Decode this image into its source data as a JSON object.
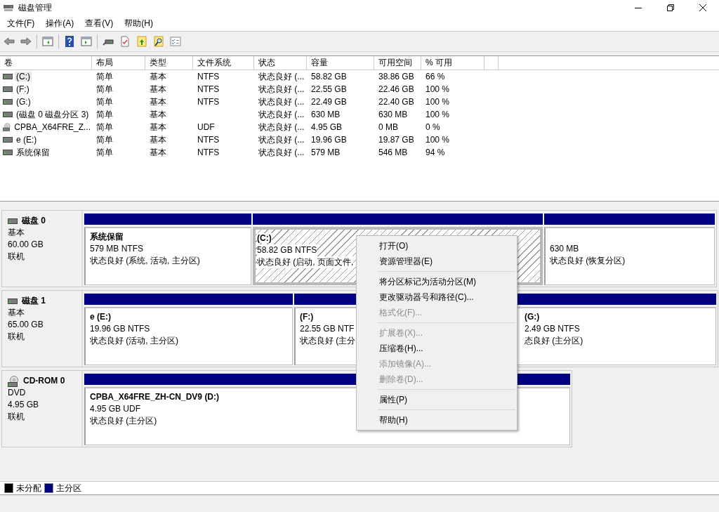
{
  "window": {
    "title": "磁盘管理"
  },
  "menu_bar": [
    "文件(F)",
    "操作(A)",
    "查看(V)",
    "帮助(H)"
  ],
  "table": {
    "columns": [
      "卷",
      "布局",
      "类型",
      "文件系统",
      "状态",
      "容量",
      "可用空间",
      "% 可用"
    ],
    "rows": [
      {
        "kind": "drive",
        "selected": true,
        "cells": [
          " (C:)",
          "简单",
          "基本",
          "NTFS",
          "状态良好 (...",
          "58.82 GB",
          "38.86 GB",
          "66 %"
        ]
      },
      {
        "kind": "drive",
        "selected": false,
        "cells": [
          " (F:)",
          "简单",
          "基本",
          "NTFS",
          "状态良好 (...",
          "22.55 GB",
          "22.46 GB",
          "100 %"
        ]
      },
      {
        "kind": "drive",
        "selected": false,
        "cells": [
          " (G:)",
          "简单",
          "基本",
          "NTFS",
          "状态良好 (...",
          "22.49 GB",
          "22.40 GB",
          "100 %"
        ]
      },
      {
        "kind": "drive",
        "selected": false,
        "cells": [
          "(磁盘 0 磁盘分区 3)",
          "简单",
          "基本",
          "",
          "状态良好 (...",
          "630 MB",
          "630 MB",
          "100 %"
        ]
      },
      {
        "kind": "cdrom",
        "selected": false,
        "cells": [
          "CPBA_X64FRE_Z...",
          "简单",
          "基本",
          "UDF",
          "状态良好 (...",
          "4.95 GB",
          "0 MB",
          "0 %"
        ]
      },
      {
        "kind": "drive",
        "selected": false,
        "cells": [
          "e (E:)",
          "简单",
          "基本",
          "NTFS",
          "状态良好 (...",
          "19.96 GB",
          "19.87 GB",
          "100 %"
        ]
      },
      {
        "kind": "drive",
        "selected": false,
        "cells": [
          "系统保留",
          "简单",
          "基本",
          "NTFS",
          "状态良好 (...",
          "579 MB",
          "546 MB",
          "94 %"
        ]
      }
    ]
  },
  "disks": [
    {
      "kind": "disk",
      "name": "磁盘 0",
      "type": "基本",
      "size": "60.00 GB",
      "status": "联机",
      "partitions": [
        {
          "title": "系统保留",
          "detail": "579 MB NTFS",
          "status": "状态良好 (系统, 活动, 主分区)",
          "selected": false
        },
        {
          "title": " (C:)",
          "detail": "58.82 GB NTFS",
          "status": "状态良好 (启动, 页面文件,",
          "selected": true
        },
        {
          "detail": "630 MB",
          "status": "状态良好 (恢复分区)",
          "selected": false
        }
      ]
    },
    {
      "kind": "disk",
      "name": "磁盘 1",
      "type": "基本",
      "size": "65.00 GB",
      "status": "联机",
      "partitions": [
        {
          "title": "e  (E:)",
          "detail": "19.96 GB NTFS",
          "status": "状态良好 (活动, 主分区)",
          "selected": false
        },
        {
          "title": " (F:)",
          "detail": "22.55 GB NTF",
          "status": "状态良好 (主分",
          "selected": false
        },
        {
          "title": "(G:)",
          "detail": "2.49 GB NTFS",
          "status": "态良好 (主分区)",
          "selected": false
        }
      ]
    },
    {
      "kind": "cdrom",
      "name": "CD-ROM 0",
      "type": "DVD",
      "size": "4.95 GB",
      "status": "联机",
      "partitions": [
        {
          "title": "CPBA_X64FRE_ZH-CN_DV9  (D:)",
          "detail": "4.95 GB UDF",
          "status": "状态良好 (主分区)",
          "selected": false
        }
      ]
    }
  ],
  "legend": [
    {
      "label": "未分配",
      "color": "#000000"
    },
    {
      "label": "主分区",
      "color": "#000080"
    }
  ],
  "context_menu": [
    {
      "kind": "item",
      "label": "打开(O)",
      "disabled": false
    },
    {
      "kind": "item",
      "label": "资源管理器(E)",
      "disabled": false
    },
    {
      "kind": "separator"
    },
    {
      "kind": "item",
      "label": "将分区标记为活动分区(M)",
      "disabled": false
    },
    {
      "kind": "item",
      "label": "更改驱动器号和路径(C)...",
      "disabled": false
    },
    {
      "kind": "item",
      "label": "格式化(F)...",
      "disabled": true
    },
    {
      "kind": "separator"
    },
    {
      "kind": "item",
      "label": "扩展卷(X)...",
      "disabled": true
    },
    {
      "kind": "item",
      "label": "压缩卷(H)...",
      "disabled": false
    },
    {
      "kind": "item",
      "label": "添加镜像(A)...",
      "disabled": true
    },
    {
      "kind": "item",
      "label": "删除卷(D)...",
      "disabled": true
    },
    {
      "kind": "separator"
    },
    {
      "kind": "item",
      "label": "属性(P)",
      "disabled": false
    },
    {
      "kind": "separator"
    },
    {
      "kind": "item",
      "label": "帮助(H)",
      "disabled": false
    }
  ]
}
